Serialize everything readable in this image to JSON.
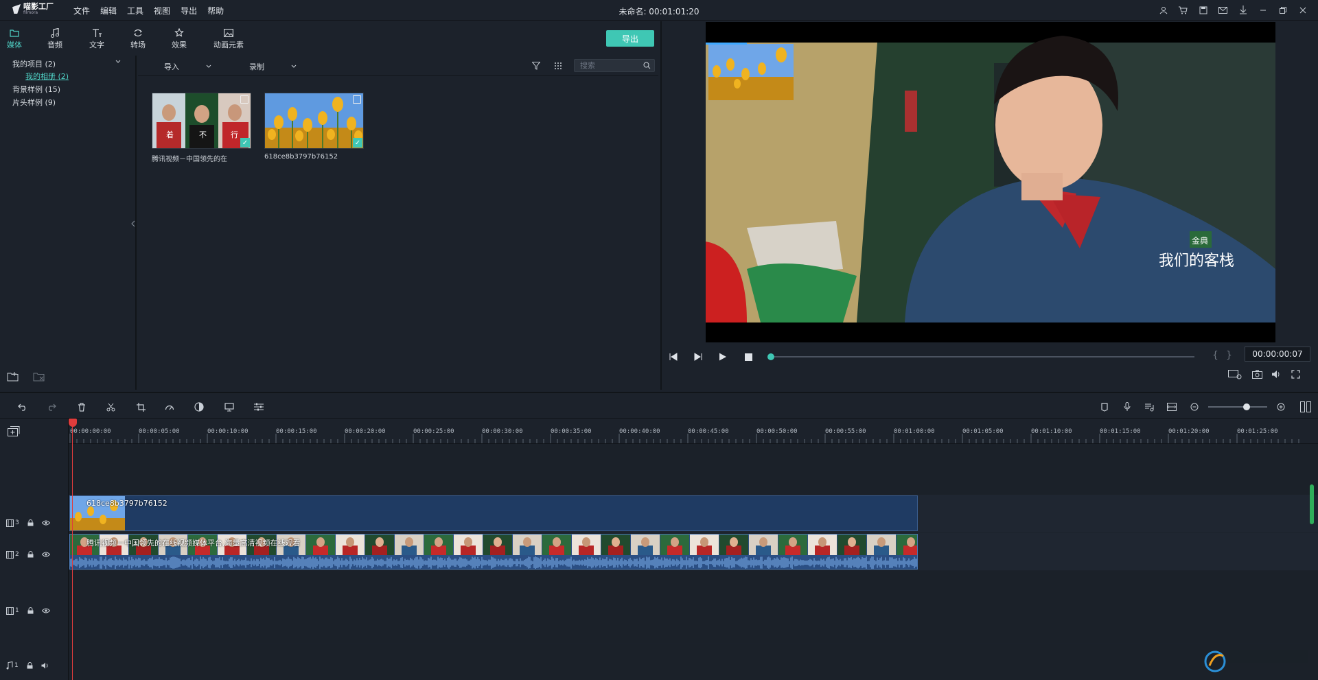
{
  "app": {
    "logo_title": "喵影工厂",
    "logo_sub": "filmora",
    "doc_title": "未命名: 00:01:01:20"
  },
  "menu": [
    "文件",
    "编辑",
    "工具",
    "视图",
    "导出",
    "帮助"
  ],
  "media_tabs": [
    {
      "label": "媒体",
      "icon": "folder-icon",
      "active": true
    },
    {
      "label": "音频",
      "icon": "music-note-icon"
    },
    {
      "label": "文字",
      "icon": "text-icon"
    },
    {
      "label": "转场",
      "icon": "transition-icon"
    },
    {
      "label": "效果",
      "icon": "effects-icon"
    },
    {
      "label": "动画元素",
      "icon": "image-icon"
    }
  ],
  "export_label": "导出",
  "tree": {
    "project": "我的项目 (2)",
    "album": "我的相册 (2)",
    "backgrounds": "背景样例 (15)",
    "intros": "片头样例 (9)"
  },
  "toolbar": {
    "import_label": "导入",
    "record_label": "录制",
    "search_placeholder": "搜索"
  },
  "media": [
    {
      "label": "腾讯视频－中国领先的在",
      "type": "video-icon"
    },
    {
      "label": "618ce8b3797b76152",
      "type": "image-icon"
    }
  ],
  "preview": {
    "timecode": "00:00:00:07",
    "progress": 0.0,
    "watermark": "我们的客栈",
    "brand": "金典"
  },
  "timeline": {
    "ruler_labels": [
      "00:00:00:00",
      "00:00:05:00",
      "00:00:10:00",
      "00:00:15:00",
      "00:00:20:00",
      "00:00:25:00",
      "00:00:30:00",
      "00:00:35:00",
      "00:00:40:00",
      "00:00:45:00",
      "00:00:50:00",
      "00:00:55:00",
      "00:01:00:00",
      "00:01:05:00",
      "00:01:10:00",
      "00:01:15:00",
      "00:01:20:00",
      "00:01:25:00"
    ],
    "tracks": [
      {
        "num": "3",
        "kind": "video"
      },
      {
        "num": "2",
        "kind": "video"
      },
      {
        "num": "1",
        "kind": "video"
      },
      {
        "num": "1",
        "kind": "audio"
      }
    ],
    "clip_image_title": "618ce8b3797b76152",
    "clip_video_title": "腾讯视频－中国领先的在线视频媒体平台,海量高清视频在线观看",
    "zoom_level": 0.65
  },
  "colors": {
    "accent": "#3fc7b4",
    "playhead": "#e03c3c",
    "clip_blue": "#1f3b63"
  }
}
